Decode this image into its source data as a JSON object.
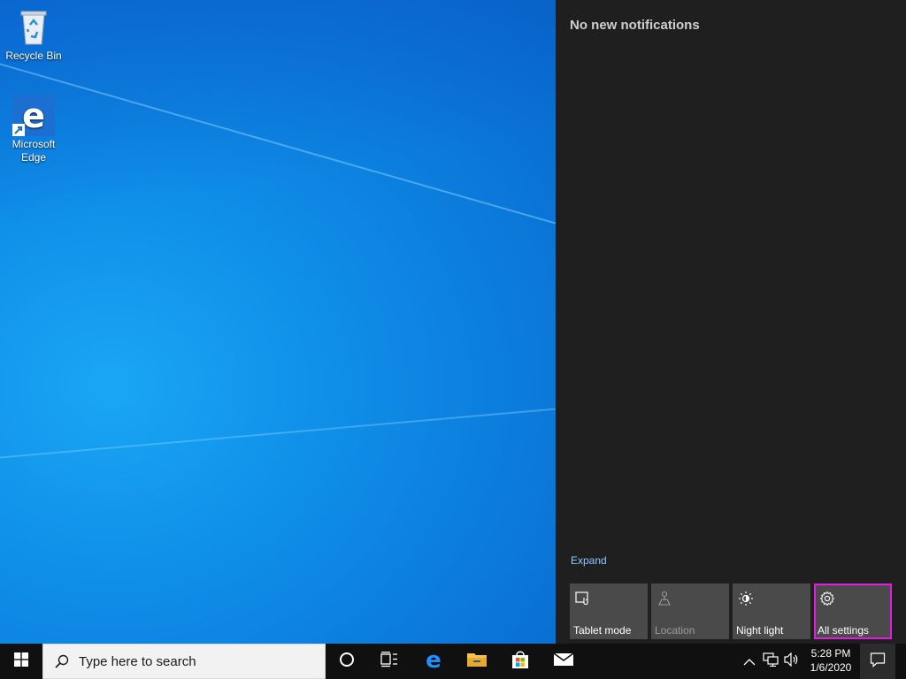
{
  "desktop": {
    "icons": [
      {
        "label": "Recycle Bin",
        "icon": "recycle-bin-icon"
      },
      {
        "label": "Microsoft Edge",
        "label_line1": "Microsoft",
        "label_line2": "Edge",
        "icon": "edge-icon"
      }
    ]
  },
  "action_center": {
    "header": "No new notifications",
    "expand_label": "Expand",
    "quick_actions": [
      {
        "label": "Tablet mode",
        "icon": "tablet-mode-icon",
        "enabled": true
      },
      {
        "label": "Location",
        "icon": "location-icon",
        "enabled": false
      },
      {
        "label": "Night light",
        "icon": "night-light-icon",
        "enabled": true
      },
      {
        "label": "All settings",
        "icon": "gear-icon",
        "enabled": true,
        "highlighted": true
      }
    ]
  },
  "taskbar": {
    "search_placeholder": "Type here to search",
    "pinned": [
      "cortana-icon",
      "task-view-icon",
      "edge-icon",
      "file-explorer-icon",
      "store-icon",
      "mail-icon"
    ],
    "tray": [
      "show-hidden-icons",
      "network-icon",
      "volume-icon"
    ],
    "clock": {
      "time": "5:28 PM",
      "date": "1/6/2020"
    }
  },
  "colors": {
    "accent_highlight": "#e21ee0",
    "action_center_bg": "#1f1f1f",
    "tile_bg": "#4a4a4a",
    "taskbar_bg": "#101010"
  }
}
